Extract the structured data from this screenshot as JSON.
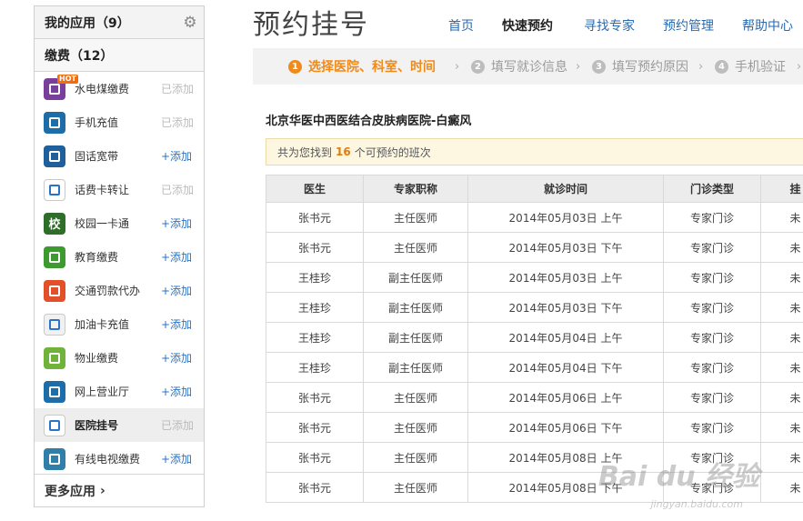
{
  "sidebar": {
    "header_title": "我的应用（9）",
    "section_title": "缴费（12）",
    "items": [
      {
        "name": "水电煤缴费",
        "action": "已添加",
        "added": true,
        "hot": "HOT",
        "icon": "utility-bill-icon",
        "color": "#7a3f9a"
      },
      {
        "name": "手机充值",
        "action": "已添加",
        "added": true,
        "icon": "mobile-phone-icon",
        "color": "#1d6ea8"
      },
      {
        "name": "固话宽带",
        "action": "+添加",
        "added": false,
        "icon": "landline-broadband-icon",
        "color": "#1f5f9c"
      },
      {
        "name": "话费卡转让",
        "action": "已添加",
        "added": true,
        "icon": "phone-card-icon",
        "color": "#ffffff"
      },
      {
        "name": "校园一卡通",
        "action": "+添加",
        "added": false,
        "icon": "campus-card-icon",
        "color": "#2f6e2a",
        "glyph": "校"
      },
      {
        "name": "教育缴费",
        "action": "+添加",
        "added": false,
        "icon": "graduation-cap-icon",
        "color": "#3d9a2f"
      },
      {
        "name": "交通罚款代办",
        "action": "+添加",
        "added": false,
        "icon": "traffic-car-icon",
        "color": "#e2502a"
      },
      {
        "name": "加油卡充值",
        "action": "+添加",
        "added": false,
        "icon": "fuel-pump-icon",
        "color": "#f1f1f1"
      },
      {
        "name": "物业缴费",
        "action": "+添加",
        "added": false,
        "icon": "property-house-icon",
        "color": "#6fb33a"
      },
      {
        "name": "网上营业厅",
        "action": "+添加",
        "added": false,
        "icon": "online-hall-icon",
        "color": "#1d6ea8"
      },
      {
        "name": "医院挂号",
        "action": "已添加",
        "added": true,
        "active": true,
        "icon": "hospital-register-icon",
        "color": "#ffffff"
      },
      {
        "name": "有线电视缴费",
        "action": "+添加",
        "added": false,
        "icon": "cable-tv-icon",
        "color": "#2f7fa8"
      }
    ],
    "more_label": "更多应用"
  },
  "page_title": "预约挂号",
  "nav": [
    {
      "label": "首页",
      "current": false
    },
    {
      "label": "快速预约",
      "current": true
    },
    {
      "label": "寻找专家",
      "current": false
    },
    {
      "label": "预约管理",
      "current": false
    },
    {
      "label": "帮助中心",
      "current": false
    }
  ],
  "steps": [
    {
      "num": "1",
      "label": "选择医院、科室、时间",
      "active": true
    },
    {
      "num": "2",
      "label": "填写就诊信息",
      "active": false
    },
    {
      "num": "3",
      "label": "填写预约原因",
      "active": false
    },
    {
      "num": "4",
      "label": "手机验证",
      "active": false
    }
  ],
  "hospital_name": "北京华医中西医结合皮肤病医院-白癜风",
  "notice": {
    "prefix": "共为您找到",
    "count": "16",
    "suffix": "个可预约的班次"
  },
  "table": {
    "headers": [
      "医生",
      "专家职称",
      "就诊时间",
      "门诊类型",
      "挂"
    ],
    "rows": [
      [
        "张书元",
        "主任医师",
        "2014年05月03日 上午",
        "专家门诊",
        "未"
      ],
      [
        "张书元",
        "主任医师",
        "2014年05月03日 下午",
        "专家门诊",
        "未"
      ],
      [
        "王桂珍",
        "副主任医师",
        "2014年05月03日 上午",
        "专家门诊",
        "未"
      ],
      [
        "王桂珍",
        "副主任医师",
        "2014年05月03日 下午",
        "专家门诊",
        "未"
      ],
      [
        "王桂珍",
        "副主任医师",
        "2014年05月04日 上午",
        "专家门诊",
        "未"
      ],
      [
        "王桂珍",
        "副主任医师",
        "2014年05月04日 下午",
        "专家门诊",
        "未"
      ],
      [
        "张书元",
        "主任医师",
        "2014年05月06日 上午",
        "专家门诊",
        "未"
      ],
      [
        "张书元",
        "主任医师",
        "2014年05月06日 下午",
        "专家门诊",
        "未"
      ],
      [
        "张书元",
        "主任医师",
        "2014年05月08日 上午",
        "专家门诊",
        "未"
      ],
      [
        "张书元",
        "主任医师",
        "2014年05月08日 下午",
        "专家门诊",
        "未"
      ]
    ]
  },
  "watermark": {
    "main": "Bai du 经验",
    "sub": "jingyan.baidu.com"
  }
}
